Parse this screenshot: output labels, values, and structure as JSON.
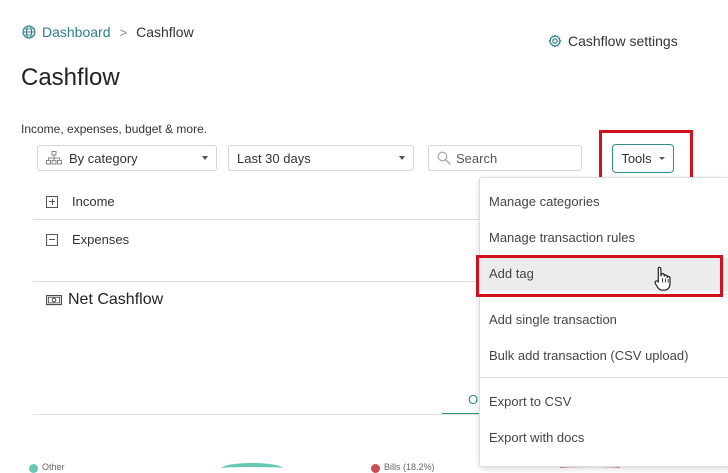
{
  "breadcrumb": {
    "home_label": "Dashboard",
    "separator": ">",
    "current_label": "Cashflow"
  },
  "header": {
    "settings_label": "Cashflow settings",
    "title": "Cashflow",
    "subtitle": "Income, expenses, budget & more."
  },
  "filters": {
    "group_by": "By category",
    "date_range": "Last 30 days",
    "search_placeholder": "Search",
    "tools_label": "Tools"
  },
  "sections": {
    "income_label": "Income",
    "expenses_label": "Expenses",
    "net_cashflow_label": "Net Cashflow",
    "tab_partial_label": "O"
  },
  "tools_menu": {
    "items": [
      "Manage categories",
      "Manage transaction rules",
      "Add tag",
      "Add single transaction",
      "Bulk add transaction (CSV upload)",
      "Export to CSV",
      "Export with docs"
    ],
    "hovered_item": "Add tag"
  },
  "bottom_partial": {
    "legend_1": "Other",
    "legend_2": "Bills (18.2%)"
  },
  "colors": {
    "accent": "#2d8d8f",
    "link": "#2d7f86",
    "highlight_box": "#d0121b",
    "legend_teal": "#67c7b4",
    "legend_red": "#d04a54"
  },
  "icons": {
    "breadcrumb": "globe-icon",
    "settings": "gear-icon",
    "group_by": "hierarchy-icon",
    "search": "search-icon",
    "net_cashflow": "banknote-icon",
    "cursor": "hand-pointer-icon"
  }
}
